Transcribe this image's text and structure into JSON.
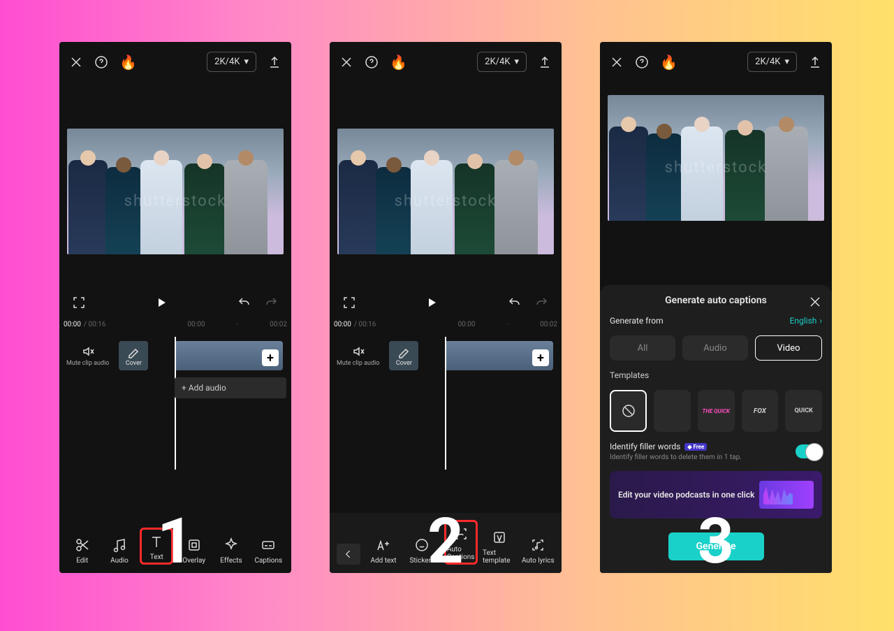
{
  "resolution_label": "2K/4K",
  "watermark": "shutterstock",
  "timeline": {
    "current": "00:00",
    "total": "00:16",
    "ticks": [
      "00:00",
      "00:02"
    ],
    "mute_label": "Mute clip audio",
    "cover_label": "Cover",
    "add_audio_label": "+  Add audio"
  },
  "toolbar_main": [
    {
      "label": "Edit"
    },
    {
      "label": "Audio"
    },
    {
      "label": "Text"
    },
    {
      "label": "Overlay"
    },
    {
      "label": "Effects"
    },
    {
      "label": "Captions"
    }
  ],
  "toolbar_text": [
    {
      "label": "Add text"
    },
    {
      "label": "Stickers"
    },
    {
      "label": "Auto Captions"
    },
    {
      "label": "Text template"
    },
    {
      "label": "Auto lyrics"
    }
  ],
  "panel": {
    "title": "Generate auto captions",
    "generate_from_label": "Generate from",
    "language": "English",
    "sources": [
      "All",
      "Audio",
      "Video"
    ],
    "selected_source": "Video",
    "templates_label": "Templates",
    "template_previews": [
      "",
      "",
      "THE QUICK",
      "FOX",
      "QUICK"
    ],
    "filler_title": "Identify filler words",
    "filler_badge": "Free",
    "filler_sub": "Identify filler words to delete them in 1 tap.",
    "promo_text": "Edit your video podcasts in one click",
    "generate_label": "Generate"
  },
  "steps": [
    "1",
    "2",
    "3"
  ]
}
